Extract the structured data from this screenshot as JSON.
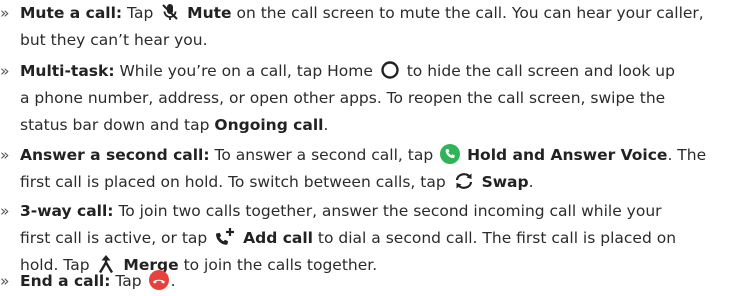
{
  "bullet": "»",
  "items": [
    {
      "term": "Mute a call:",
      "l1a": "Tap",
      "l1b": "Mute",
      "l1c": "on the call screen to mute the call. You can hear your caller,",
      "l2": "but they can’t hear you."
    },
    {
      "term": "Multi-task:",
      "l1a": "While you’re on a call, tap Home",
      "l1b": "to hide the call screen and look up",
      "l2": "a phone number, address, or open other apps. To reopen the call screen, swipe the",
      "l3a": "status bar down and tap",
      "l3b": "Ongoing call",
      "l3c": "."
    },
    {
      "term": "Answer a second call:",
      "l1a": "To answer a second call, tap",
      "l1b": "Hold and Answer Voice",
      "l1c": ". The",
      "l2a": "first call is placed on hold. To switch between calls, tap",
      "l2b": "Swap",
      "l2c": "."
    },
    {
      "term": "3-way call:",
      "l1a": "To join two calls together, answer the second incoming call while your",
      "l2a": "first call is active, or tap",
      "l2b": "Add call",
      "l2c": "to dial a second call. The first call is placed on",
      "l3a": "hold. Tap",
      "l3b": "Merge",
      "l3c": "to join the calls together."
    },
    {
      "term": "End a call:",
      "l1a": "Tap",
      "l1b": "."
    }
  ],
  "colors": {
    "text": "#2b2b2b",
    "answer_green": "#2fb45a",
    "end_red": "#e8413c"
  },
  "icons": {
    "mute": "mic-off-icon",
    "home": "home-circle-icon",
    "answer": "answer-call-icon",
    "swap": "swap-icon",
    "add_call": "add-call-icon",
    "merge": "merge-icon",
    "end_call": "end-call-icon"
  }
}
